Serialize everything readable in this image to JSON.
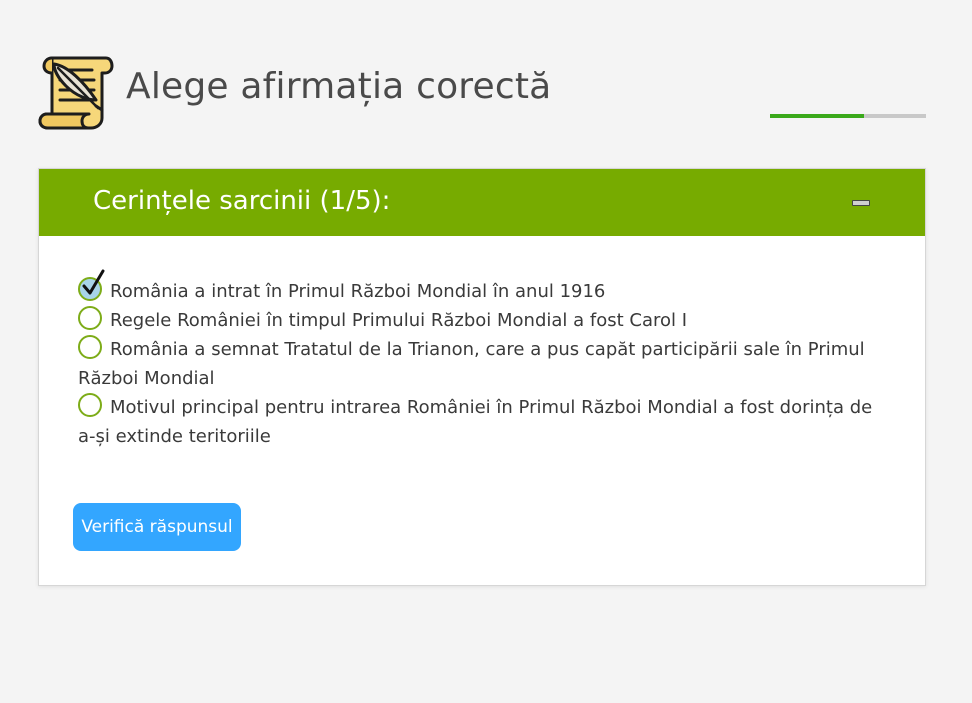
{
  "header": {
    "title": "Alege afirmația corectă",
    "progress_fraction": 0.6
  },
  "task": {
    "title": "Cerințele sarcinii (1/5):",
    "options": [
      {
        "label": "România a intrat în Primul Război Mondial în anul 1916",
        "selected": true
      },
      {
        "label": "Regele României în timpul Primului Război Mondial a fost Carol I",
        "selected": false
      },
      {
        "label": "România a semnat Tratatul de la Trianon, care a pus capăt participării sale în Primul Război Mondial",
        "selected": false
      },
      {
        "label": "Motivul principal pentru intrarea României în Primul Război Mondial a fost dorința de a-și extinde teritoriile",
        "selected": false
      }
    ],
    "verify_label": "Verifică răspunsul"
  },
  "icons": {
    "page": "scroll-quill-icon",
    "collapse": "minus-icon",
    "selected": "checkmark-icon"
  },
  "colors": {
    "accent_green": "#77ab00",
    "radio_border": "#7dac18",
    "progress_fill": "#3aa91a",
    "button_blue": "#33a6ff",
    "selected_fill": "#a8d4e8"
  }
}
